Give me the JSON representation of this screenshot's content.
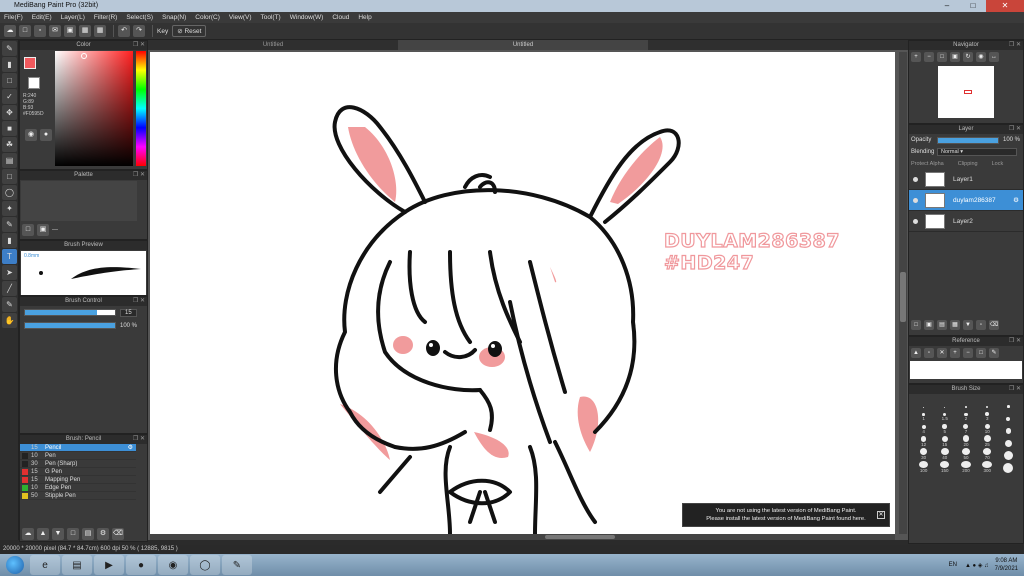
{
  "app": {
    "title": "MediBang Paint Pro (32bit)"
  },
  "menu": [
    "File(F)",
    "Edit(E)",
    "Layer(L)",
    "Filter(R)",
    "Select(S)",
    "Snap(N)",
    "Color(C)",
    "View(V)",
    "Tool(T)",
    "Window(W)",
    "Cloud",
    "Help"
  ],
  "toolbar": {
    "key_label": "Key",
    "reset_label": "Reset"
  },
  "tabs": [
    "Untitled",
    "Untitled"
  ],
  "color_panel": {
    "title": "Color",
    "rgb_lines": [
      "R:240",
      "G:89",
      "B:93",
      "#F0595D"
    ],
    "fg_color": "#f0595d"
  },
  "palette_panel": {
    "title": "Palette",
    "value": "---"
  },
  "brush_preview": {
    "title": "Brush Preview",
    "size_label": "0.8mm"
  },
  "brush_control": {
    "title": "Brush Control",
    "size_value": "15",
    "opacity_value": "100 %",
    "size_fraction": 0.8,
    "opacity_fraction": 1.0
  },
  "brush_list": {
    "title": "Brush: Pencil",
    "items": [
      {
        "size": "15",
        "name": "Pencil",
        "color": "#3d8fd6",
        "selected": true
      },
      {
        "size": "10",
        "name": "Pen",
        "color": "#222222",
        "selected": false
      },
      {
        "size": "30",
        "name": "Pen (Sharp)",
        "color": "#222222",
        "selected": false
      },
      {
        "size": "15",
        "name": "G Pen",
        "color": "#e03030",
        "selected": false
      },
      {
        "size": "15",
        "name": "Mapping Pen",
        "color": "#e03030",
        "selected": false
      },
      {
        "size": "10",
        "name": "Edge Pen",
        "color": "#30b030",
        "selected": false
      },
      {
        "size": "50",
        "name": "Stipple Pen",
        "color": "#e0c020",
        "selected": false
      }
    ]
  },
  "canvas": {
    "watermark_line1": "DUYLAM286387",
    "watermark_line2": "#HD247",
    "stroke_color": "#111111",
    "accent_pink": "#f19b9c"
  },
  "notice": {
    "line1": "You are not using the latest version of MediBang Paint.",
    "line2": "Please install the latest version of MediBang Paint found here."
  },
  "navigator": {
    "title": "Navigator"
  },
  "layer_panel": {
    "title": "Layer",
    "opacity_label": "Opacity",
    "opacity_value": "100 %",
    "opacity_fraction": 1.0,
    "blending_label": "Blending",
    "blending_value": "Normal",
    "protect_alpha": "Protect Alpha",
    "clipping": "Clipping",
    "lock": "Lock",
    "layers": [
      {
        "name": "Layer1",
        "selected": false
      },
      {
        "name": "duylam286387",
        "selected": true
      },
      {
        "name": "Layer2",
        "selected": false
      }
    ]
  },
  "reference": {
    "title": "Reference"
  },
  "brush_size": {
    "title": "Brush Size",
    "sizes": [
      "",
      "",
      "",
      "",
      "",
      "1",
      "1.5",
      "2",
      "3",
      "",
      "4",
      "5",
      "7",
      "10",
      "",
      "12",
      "15",
      "20",
      "25",
      "",
      "30",
      "40",
      "50",
      "70",
      "",
      "100",
      "150",
      "200",
      "300",
      ""
    ]
  },
  "status": {
    "text": "20000 * 20000 pixel  (84.7 * 84.7cm)  600 dpi  50 %  ( 12885, 9815 )"
  },
  "taskbar": {
    "lang": "EN",
    "time": "9:08 AM",
    "date": "7/9/2021"
  }
}
